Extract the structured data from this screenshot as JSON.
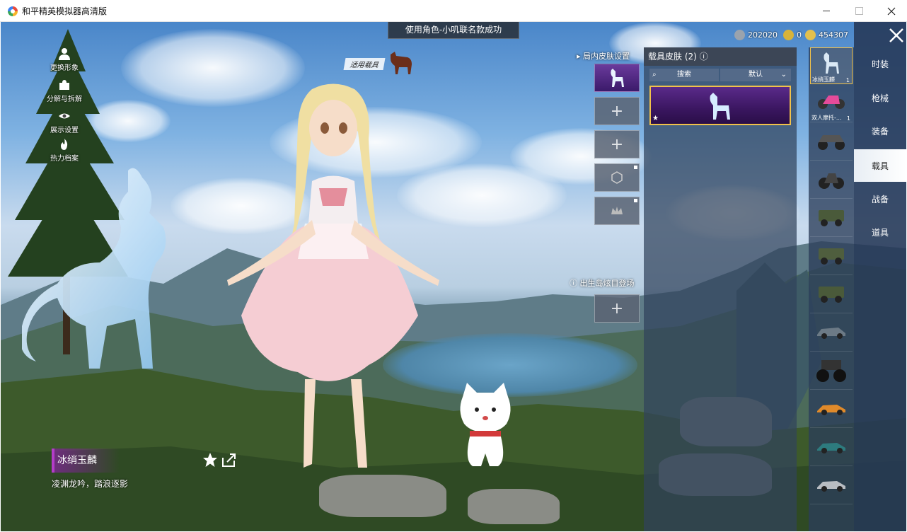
{
  "window": {
    "title": "和平精英模拟器高清版"
  },
  "toast": "使用角色-小叽联名款成功",
  "vehicle_tag": "适用载具",
  "currency": [
    {
      "icon": "coin-silver-icon",
      "value": "202020",
      "color": "#9aa3ad"
    },
    {
      "icon": "coin-gold-a-icon",
      "value": "0",
      "color": "#d7b33a"
    },
    {
      "icon": "coin-gold-icon",
      "value": "454307",
      "color": "#e3c04d"
    }
  ],
  "left_menu": [
    {
      "label": "更换形象",
      "icon": "person-icon"
    },
    {
      "label": "分解与拆解",
      "icon": "puzzle-icon"
    },
    {
      "label": "展示设置",
      "icon": "eye-icon"
    },
    {
      "label": "热力档案",
      "icon": "flame-icon"
    }
  ],
  "slots": {
    "in_game_label": "局内皮肤设置",
    "spawn_label": "出生岛炫目登场"
  },
  "panel": {
    "title": "载具皮肤 (2)",
    "help_icon": "help-circle-icon",
    "search_label": "搜索",
    "sort_label": "默认"
  },
  "thumbs": [
    {
      "caption": "冰绡玉麟",
      "count": "1",
      "kind": "horse",
      "selected": true
    },
    {
      "caption": "双人摩托-...",
      "count": "1",
      "kind": "moto-pink"
    },
    {
      "caption": "",
      "kind": "buggy"
    },
    {
      "caption": "",
      "kind": "moto"
    },
    {
      "caption": "",
      "kind": "jeep"
    },
    {
      "caption": "",
      "kind": "jeep"
    },
    {
      "caption": "",
      "kind": "jeep"
    },
    {
      "caption": "",
      "kind": "sedan"
    },
    {
      "caption": "",
      "kind": "monster-truck"
    },
    {
      "caption": "",
      "kind": "sports-car-orange"
    },
    {
      "caption": "",
      "kind": "sports-car-teal"
    },
    {
      "caption": "",
      "kind": "sports-car-silver"
    }
  ],
  "sidebar": [
    {
      "label": "时装"
    },
    {
      "label": "枪械"
    },
    {
      "label": "装备"
    },
    {
      "label": "载具",
      "active": true
    },
    {
      "label": "战备"
    },
    {
      "label": "道具"
    }
  ],
  "item": {
    "name": "冰绡玉麟",
    "desc": "凌渊龙吟，踏浪逐影"
  }
}
